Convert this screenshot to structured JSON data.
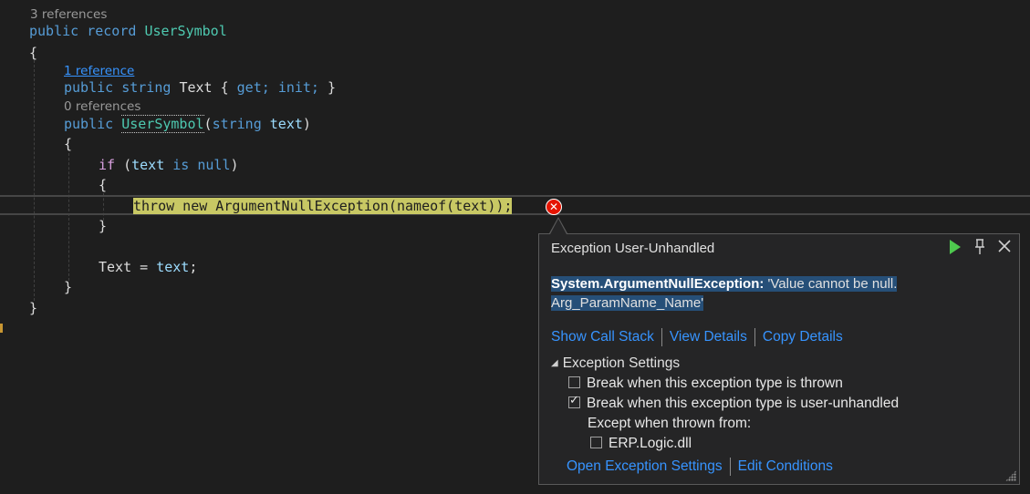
{
  "code": {
    "lens_record": "3 references",
    "l_record": [
      "public",
      "record",
      "UserSymbol"
    ],
    "brace_open_1": "{",
    "lens_text_prop": "1 reference",
    "l_prop": [
      "public",
      "string",
      "Text",
      "{",
      "get;",
      "init;",
      "}"
    ],
    "lens_ctor": "0 references",
    "l_ctor": [
      "public",
      "UserSymbol",
      "(",
      "string",
      "text",
      ")"
    ],
    "brace_open_2": "{",
    "l_if": [
      "if",
      "(",
      "text",
      "is",
      "null",
      ")"
    ],
    "brace_open_3": "{",
    "l_throw": "throw new ArgumentNullException(nameof(text));",
    "brace_close_3": "}",
    "l_assign": [
      "Text",
      "=",
      "text",
      ";"
    ],
    "brace_close_2": "}",
    "brace_close_1": "}"
  },
  "exception_popup": {
    "title": "Exception User-Unhandled",
    "continue_icon": "play-icon",
    "pin_icon": "pin-icon",
    "close_icon": "close-icon",
    "exception_type": "System.ArgumentNullException:",
    "message_line1": "'Value cannot be null.",
    "message_line2": "Arg_ParamName_Name'",
    "link_call_stack": "Show Call Stack",
    "link_view_details": "View Details",
    "link_copy_details": "Copy Details",
    "settings_header": "Exception Settings",
    "opt_break_thrown": {
      "label": "Break when this exception type is thrown",
      "checked": false
    },
    "opt_break_unhandled": {
      "label": "Break when this exception type is user-unhandled",
      "checked": true
    },
    "except_when_label": "Except when thrown from:",
    "opt_erp_logic": {
      "label": "ERP.Logic.dll",
      "checked": false
    },
    "link_open_settings": "Open Exception Settings",
    "link_edit_conditions": "Edit Conditions"
  },
  "colors": {
    "background": "#1e1e1e",
    "keyword": "#569cd6",
    "type": "#4ec9b0",
    "control": "#d8a0df",
    "parameter": "#9cdcfe",
    "statement_highlight": "#c8c864",
    "error": "#e51400",
    "link": "#3794ff",
    "continue_green": "#4ec94e"
  }
}
